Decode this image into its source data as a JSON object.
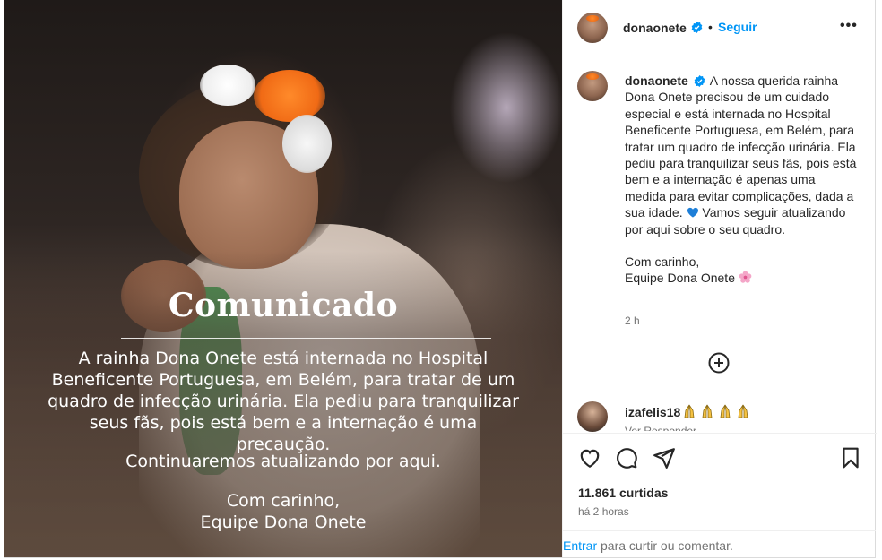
{
  "post": {
    "image": {
      "title": "Comunicado",
      "body": "A rainha Dona Onete está internada no Hospital Beneficente Portuguesa, em Belém, para tratar de um quadro de infecção urinária. Ela pediu para tranquilizar seus fãs, pois está bem e a internação é uma precaução.",
      "update": "Continuaremos atualizando por aqui.",
      "signoff_1": "Com carinho,",
      "signoff_2": "Equipe Dona Onete"
    },
    "header": {
      "username": "donaonete",
      "separator": "•",
      "follow_label": "Seguir",
      "more_label": "•••"
    },
    "caption": {
      "username": "donaonete",
      "text": "A nossa querida rainha Dona Onete precisou de um cuidado especial e está internada no Hospital Beneficente Portuguesa, em Belém, para tratar um quadro de infecção urinária. Ela pediu para tranquilizar seus fãs, pois está bem e a internação é apenas uma medida para evitar complicações, dada a sua idade.",
      "text_2": "Vamos seguir atualizando por aqui sobre o seu quadro.",
      "signoff_1": "Com carinho,",
      "signoff_2": "Equipe Dona Onete",
      "time": "2 h"
    },
    "comment": {
      "username": "izafelis18",
      "cut_text": "Ver Responder"
    },
    "likes": "11.861 curtidas",
    "posted_ago": "há 2 horas",
    "login": {
      "link": "Entrar",
      "text": "para curtir ou comentar."
    },
    "colors": {
      "accent": "#0095f6",
      "verified": "#0095f6",
      "heart_emoji": "#1e7fd8",
      "flower_emoji": "#f4a6c8",
      "pray_emoji": "#f5c242"
    }
  }
}
